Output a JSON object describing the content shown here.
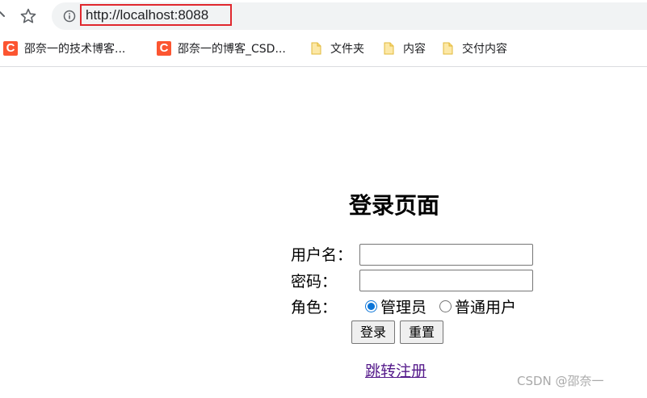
{
  "browser": {
    "url": "http://localhost:8088",
    "bookmarks": [
      {
        "label": "邵奈一的技术博客...",
        "icon": "csdn-icon"
      },
      {
        "label": "邵奈一的博客_CSD...",
        "icon": "csdn-icon"
      },
      {
        "label": "文件夹",
        "icon": "folder-icon"
      },
      {
        "label": "内容",
        "icon": "folder-icon"
      },
      {
        "label": "交付内容",
        "icon": "folder-icon"
      }
    ],
    "csdn_icon_letter": "C",
    "highlight_color": "#e0282e"
  },
  "login": {
    "title": "登录页面",
    "username_label": "用户名：",
    "username_value": "",
    "password_label": "密码：",
    "password_value": "",
    "role_label": "角色：",
    "role_options": [
      {
        "label": "管理员",
        "selected": true
      },
      {
        "label": "普通用户",
        "selected": false
      }
    ],
    "login_button": "登录",
    "reset_button": "重置",
    "register_link": "跳转注册"
  },
  "watermark": "CSDN @邵奈一"
}
